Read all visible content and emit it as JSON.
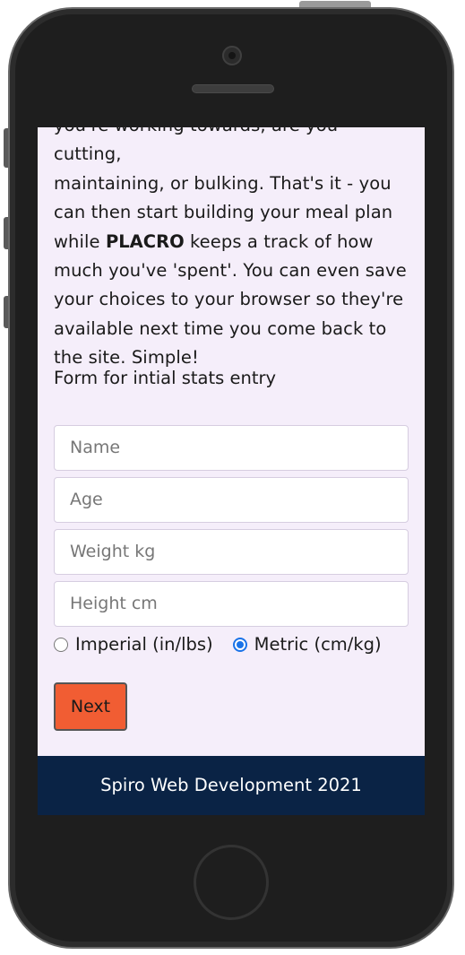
{
  "intro": {
    "line_partial": "you're working towards, are you cutting,",
    "line2": "maintaining, or bulking. That's it - you",
    "line3": "can then start building your meal plan",
    "line4_prefix": "while ",
    "brand": "PLACRO",
    "line4_suffix": " keeps a track of how",
    "line5": "much you've 'spent'. You can even save",
    "line6": "your choices to your browser so they're",
    "line7": "available next time you come back to",
    "line8": "the site. Simple!"
  },
  "form": {
    "title": "Form for intial stats entry",
    "name_placeholder": "Name",
    "age_placeholder": "Age",
    "weight_placeholder": "Weight kg",
    "height_placeholder": "Height cm",
    "units": {
      "imperial_label": "Imperial (in/lbs)",
      "metric_label": "Metric (cm/kg)",
      "selected": "metric"
    },
    "next_label": "Next"
  },
  "footer": {
    "text": "Spiro Web Development 2021"
  },
  "colors": {
    "screen_bg": "#f5eefa",
    "button": "#f15d33",
    "footer_bg": "#0a2345",
    "radio_selected": "#1a73e8"
  }
}
